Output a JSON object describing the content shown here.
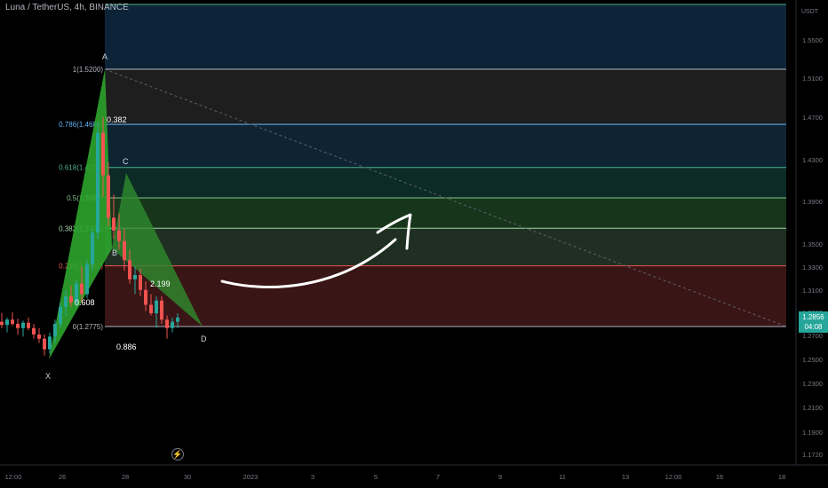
{
  "header": {
    "symbol_title": "Luna / TetherUS, 4h, BINANCE"
  },
  "currency": "USDT",
  "last_price": {
    "value": "1.2856",
    "countdown": "04:08",
    "color": "#26a69a"
  },
  "replay_icon": "lightning-icon",
  "chart_data": {
    "type": "candlestick",
    "y_axis": {
      "ticks": [
        "1.5500",
        "1.5100",
        "1.4700",
        "1.4300",
        "1.3900",
        "1.3500",
        "1.3300",
        "1.3100",
        "1.2900",
        "1.2700",
        "1.2500",
        "1.2300",
        "1.2100",
        "1.1900",
        "1.1720"
      ]
    },
    "x_axis": {
      "ticks": [
        "12:00",
        "26",
        "28",
        "30",
        "2023",
        "3",
        "5",
        "7",
        "9",
        "11",
        "13",
        "12:00",
        "16",
        "18"
      ]
    },
    "fib_levels": [
      {
        "ratio": "1",
        "price": 1.52,
        "label": "1(1.5200)",
        "color": "#b2b5be",
        "band": "#1e1e1e"
      },
      {
        "ratio": "0.786",
        "price": 1.4681,
        "label": "0.786(1.4681)",
        "color": "#64b5f6",
        "band": "#0f2433"
      },
      {
        "ratio": "0.618",
        "price": 1.4274,
        "label": "0.618(1.4274)",
        "color": "#4caf8a",
        "band": "#0c2a26"
      },
      {
        "ratio": "0.5",
        "price": 1.3987,
        "label": "0.5(1.3987)",
        "color": "#81c784",
        "band": "#17351b"
      },
      {
        "ratio": "0.382",
        "price": 1.3701,
        "label": "0.382(1.3701)",
        "color": "#a5d6a7",
        "band": "#1f3022"
      },
      {
        "ratio": "0.236",
        "price": 1.3347,
        "label": "0.236(1.3347)",
        "color": "#ef5350",
        "band": "#3a1515"
      },
      {
        "ratio": "0",
        "price": 1.2775,
        "label": "0(1.2775)",
        "color": "#b2b5be",
        "band": null
      }
    ],
    "harmonic_points": [
      "X",
      "A",
      "B",
      "C",
      "D"
    ],
    "harmonic_ratios": [
      "0.382",
      "2.199",
      "0.886",
      "0.608"
    ],
    "candles": [
      {
        "o": 1.282,
        "h": 1.29,
        "l": 1.276,
        "c": 1.279
      },
      {
        "o": 1.279,
        "h": 1.286,
        "l": 1.272,
        "c": 1.284
      },
      {
        "o": 1.284,
        "h": 1.291,
        "l": 1.278,
        "c": 1.28
      },
      {
        "o": 1.28,
        "h": 1.285,
        "l": 1.27,
        "c": 1.276
      },
      {
        "o": 1.276,
        "h": 1.283,
        "l": 1.268,
        "c": 1.281
      },
      {
        "o": 1.281,
        "h": 1.286,
        "l": 1.274,
        "c": 1.276
      },
      {
        "o": 1.276,
        "h": 1.28,
        "l": 1.266,
        "c": 1.27
      },
      {
        "o": 1.27,
        "h": 1.276,
        "l": 1.262,
        "c": 1.266
      },
      {
        "o": 1.266,
        "h": 1.27,
        "l": 1.25,
        "c": 1.256
      },
      {
        "o": 1.256,
        "h": 1.272,
        "l": 1.252,
        "c": 1.268
      },
      {
        "o": 1.268,
        "h": 1.284,
        "l": 1.262,
        "c": 1.28
      },
      {
        "o": 1.28,
        "h": 1.3,
        "l": 1.276,
        "c": 1.296
      },
      {
        "o": 1.296,
        "h": 1.312,
        "l": 1.288,
        "c": 1.306
      },
      {
        "o": 1.306,
        "h": 1.316,
        "l": 1.296,
        "c": 1.3
      },
      {
        "o": 1.3,
        "h": 1.322,
        "l": 1.296,
        "c": 1.318
      },
      {
        "o": 1.318,
        "h": 1.334,
        "l": 1.3,
        "c": 1.308
      },
      {
        "o": 1.308,
        "h": 1.34,
        "l": 1.304,
        "c": 1.336
      },
      {
        "o": 1.336,
        "h": 1.37,
        "l": 1.33,
        "c": 1.366
      },
      {
        "o": 1.366,
        "h": 1.47,
        "l": 1.36,
        "c": 1.46
      },
      {
        "o": 1.46,
        "h": 1.475,
        "l": 1.4,
        "c": 1.42
      },
      {
        "o": 1.42,
        "h": 1.432,
        "l": 1.372,
        "c": 1.38
      },
      {
        "o": 1.38,
        "h": 1.402,
        "l": 1.36,
        "c": 1.368
      },
      {
        "o": 1.368,
        "h": 1.384,
        "l": 1.35,
        "c": 1.358
      },
      {
        "o": 1.358,
        "h": 1.37,
        "l": 1.33,
        "c": 1.34
      },
      {
        "o": 1.34,
        "h": 1.35,
        "l": 1.318,
        "c": 1.322
      },
      {
        "o": 1.322,
        "h": 1.334,
        "l": 1.308,
        "c": 1.326
      },
      {
        "o": 1.326,
        "h": 1.332,
        "l": 1.306,
        "c": 1.312
      },
      {
        "o": 1.312,
        "h": 1.32,
        "l": 1.292,
        "c": 1.298
      },
      {
        "o": 1.298,
        "h": 1.308,
        "l": 1.288,
        "c": 1.29
      },
      {
        "o": 1.29,
        "h": 1.306,
        "l": 1.276,
        "c": 1.302
      },
      {
        "o": 1.302,
        "h": 1.306,
        "l": 1.28,
        "c": 1.284
      },
      {
        "o": 1.284,
        "h": 1.288,
        "l": 1.266,
        "c": 1.276
      },
      {
        "o": 1.276,
        "h": 1.286,
        "l": 1.272,
        "c": 1.282
      },
      {
        "o": 1.282,
        "h": 1.29,
        "l": 1.276,
        "c": 1.286
      }
    ]
  }
}
